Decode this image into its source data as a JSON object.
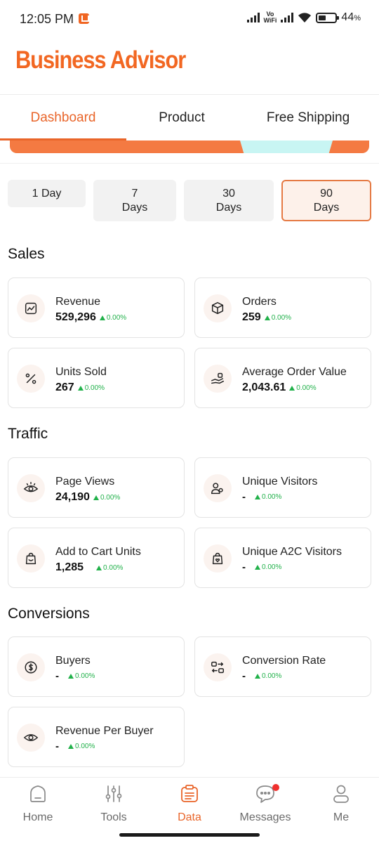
{
  "status_bar": {
    "time": "12:05 PM",
    "vo_wifi_top": "Vo",
    "vo_wifi_bottom": "WiFi",
    "battery_percent": "44",
    "battery_percent_symbol": "%",
    "battery_level": 0.44
  },
  "header": {
    "title": "Business Advisor"
  },
  "tabs": [
    {
      "label": "Dashboard",
      "active": true
    },
    {
      "label": "Product",
      "active": false
    },
    {
      "label": "Free Shipping",
      "active": false
    }
  ],
  "periods": [
    {
      "line1": "1 Day",
      "line2": "",
      "active": false
    },
    {
      "line1": "7",
      "line2": "Days",
      "active": false
    },
    {
      "line1": "30",
      "line2": "Days",
      "active": false
    },
    {
      "line1": "90",
      "line2": "Days",
      "active": true
    }
  ],
  "sections": {
    "sales": {
      "title": "Sales",
      "cards": [
        {
          "label": "Revenue",
          "value": "529,296",
          "change": "0.00%",
          "icon": "revenue-chart-icon"
        },
        {
          "label": "Orders",
          "value": "259",
          "change": "0.00%",
          "icon": "box-icon"
        },
        {
          "label": "Units Sold",
          "value": "267",
          "change": "0.00%",
          "icon": "percent-icon"
        },
        {
          "label": "Average Order Value",
          "value": "2,043.61",
          "change": "0.00%",
          "icon": "hand-coin-icon"
        }
      ]
    },
    "traffic": {
      "title": "Traffic",
      "cards": [
        {
          "label": "Page Views",
          "value": "24,190",
          "change": "0.00%",
          "icon": "eye-icon"
        },
        {
          "label": "Unique Visitors",
          "value": "-",
          "change": "0.00%",
          "icon": "users-icon"
        },
        {
          "label": "Add to Cart Units",
          "value": "1,285",
          "change": "0.00%",
          "icon": "bag-icon"
        },
        {
          "label": "Unique A2C Visitors",
          "value": "-",
          "change": "0.00%",
          "icon": "bag-heart-icon"
        }
      ]
    },
    "conversions": {
      "title": "Conversions",
      "cards": [
        {
          "label": "Buyers",
          "value": "-",
          "change": "0.00%",
          "icon": "dollar-icon"
        },
        {
          "label": "Conversion Rate",
          "value": "-",
          "change": "0.00%",
          "icon": "conversion-icon"
        },
        {
          "label": "Revenue Per Buyer",
          "value": "-",
          "change": "0.00%",
          "icon": "eye-icon"
        }
      ]
    }
  },
  "bottom_nav": [
    {
      "label": "Home",
      "icon": "home-icon",
      "active": false
    },
    {
      "label": "Tools",
      "icon": "sliders-icon",
      "active": false
    },
    {
      "label": "Data",
      "icon": "data-clipboard-icon",
      "active": true
    },
    {
      "label": "Messages",
      "icon": "chat-bubble-icon",
      "active": false,
      "badge": true
    },
    {
      "label": "Me",
      "icon": "person-icon",
      "active": false
    }
  ],
  "colors": {
    "accent": "#e9652a",
    "brand": "#f26722",
    "positive": "#21b14a",
    "banner_orange": "#f47a42",
    "banner_cyan": "#c8f5f3"
  }
}
